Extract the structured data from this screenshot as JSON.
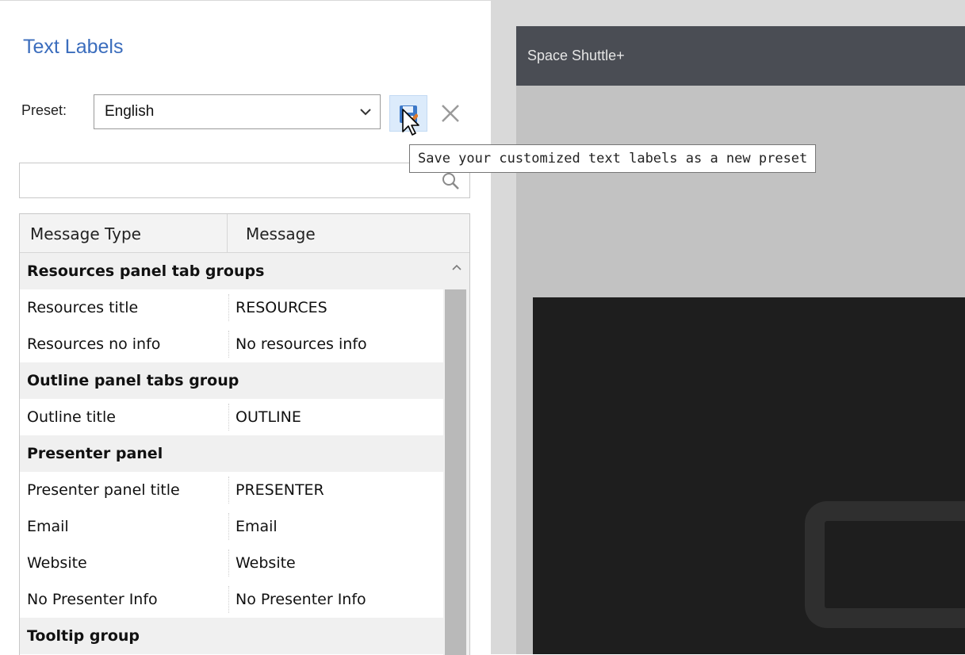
{
  "panel": {
    "title": "Text Labels",
    "preset_label": "Preset:",
    "preset_value": "English",
    "search_placeholder": ""
  },
  "tooltip": "Save your customized text labels as a new preset",
  "table": {
    "headers": [
      "Message Type",
      "Message"
    ],
    "rows": [
      {
        "type": "Resources panel tab groups",
        "message": "",
        "group": true
      },
      {
        "type": "Resources title",
        "message": "RESOURCES",
        "group": false
      },
      {
        "type": "Resources no info",
        "message": "No resources info",
        "group": false
      },
      {
        "type": "Outline panel tabs group",
        "message": "",
        "group": true
      },
      {
        "type": "Outline title",
        "message": "OUTLINE",
        "group": false
      },
      {
        "type": "Presenter panel",
        "message": "",
        "group": true
      },
      {
        "type": "Presenter panel title",
        "message": "PRESENTER",
        "group": false
      },
      {
        "type": "Email",
        "message": "Email",
        "group": false
      },
      {
        "type": "Website",
        "message": "Website",
        "group": false
      },
      {
        "type": "No Presenter Info",
        "message": "No Presenter Info",
        "group": false
      },
      {
        "type": "Tooltip group",
        "message": "",
        "group": true
      }
    ]
  },
  "preview": {
    "player_title": "Space Shuttle+"
  },
  "icons": {
    "save": "save-icon",
    "delete": "close-icon",
    "search": "search-icon",
    "dropdown": "chevron-down-icon"
  },
  "colors": {
    "title_blue": "#3b6dbd",
    "save_highlight": "#dcebfb",
    "player_titlebar": "#4a4d54"
  }
}
